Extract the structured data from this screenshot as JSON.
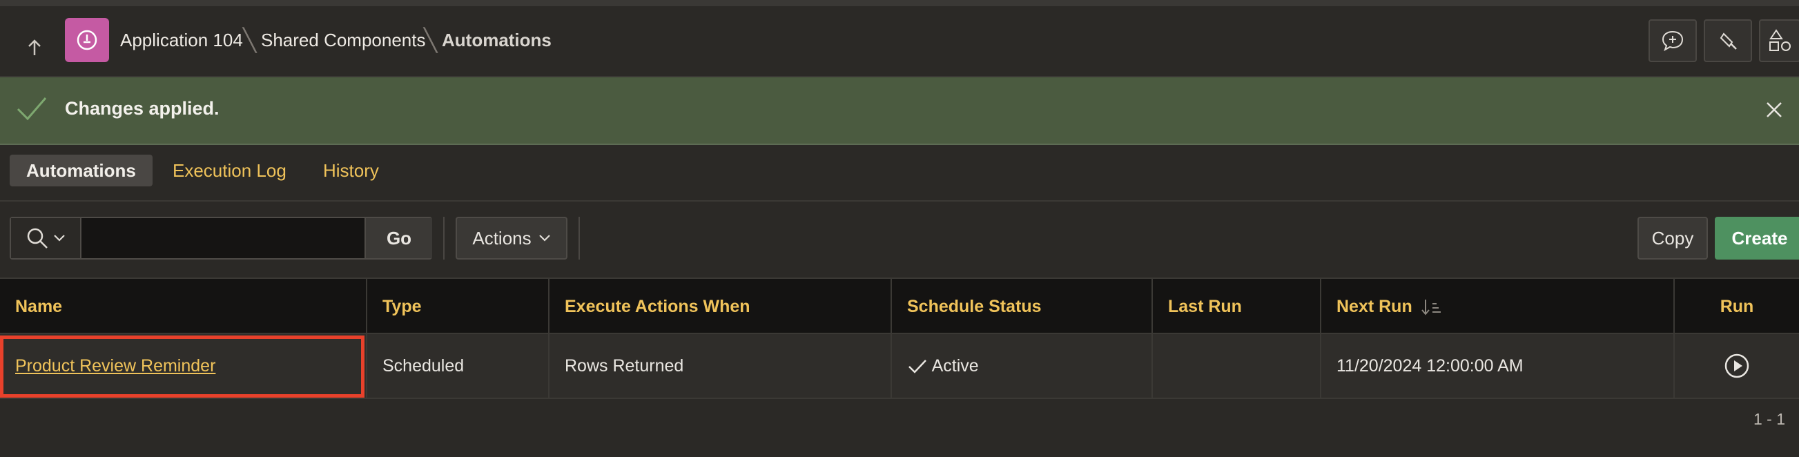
{
  "header": {
    "breadcrumbs": [
      "Application 104",
      "Shared Components",
      "Automations"
    ],
    "icons": [
      "up-arrow-icon",
      "app-icon",
      "feedback-icon",
      "highlighter-icon",
      "shapes-icon"
    ]
  },
  "alert": {
    "message": "Changes applied."
  },
  "tabs": [
    {
      "label": "Automations",
      "active": true
    },
    {
      "label": "Execution Log",
      "active": false
    },
    {
      "label": "History",
      "active": false
    }
  ],
  "toolbar": {
    "search_value": "",
    "go_label": "Go",
    "actions_label": "Actions",
    "copy_label": "Copy",
    "create_label": "Create"
  },
  "table": {
    "columns": [
      "Name",
      "Type",
      "Execute Actions When",
      "Schedule Status",
      "Last Run",
      "Next Run",
      "Run"
    ],
    "rows": [
      {
        "name": "Product Review Reminder",
        "type": "Scheduled",
        "execute_actions_when": "Rows Returned",
        "schedule_status": "Active",
        "last_run": "",
        "next_run": "11/20/2024 12:00:00 AM"
      }
    ],
    "pagination": "1 - 1"
  },
  "colors": {
    "accent": "#f0c35a",
    "create": "#4e9160",
    "alert_bg": "#4b5b40",
    "app_icon": "#c55aa3",
    "highlight": "#e8412b"
  }
}
